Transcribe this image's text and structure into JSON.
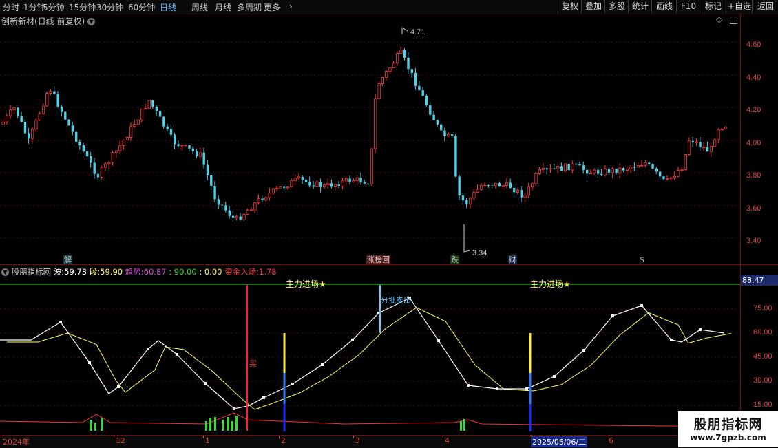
{
  "toolbar": {
    "periods": [
      "分时",
      "1分钟",
      "5分钟",
      "15分钟",
      "30分钟",
      "60分钟",
      "日线",
      "周线",
      "月线",
      "多周期",
      "更多"
    ],
    "active_period": "日线",
    "tools": [
      "复权",
      "叠加",
      "多股",
      "统计",
      "画线",
      "F10",
      "标记",
      "+自选",
      "返回"
    ]
  },
  "main_chart": {
    "title": "创新新材(日线 前复权)",
    "price_ticks": [
      "4.60",
      "4.40",
      "4.20",
      "4.00",
      "3.80",
      "3.60",
      "3.40"
    ],
    "high_label": "4.71",
    "low_label": "3.34",
    "events": [
      {
        "text": "解",
        "color": "#4fd1e8"
      },
      {
        "text": "涨榜回",
        "color": "#e0e0e0"
      },
      {
        "text": "跌",
        "color": "#33dd33"
      },
      {
        "text": "财",
        "color": "#5ab0ff"
      },
      {
        "text": "$",
        "color": "#ff3030"
      }
    ]
  },
  "indicator": {
    "name": "股朋指标网",
    "wave_label": "波:",
    "wave_value": "59.73",
    "segment_label": "段:",
    "segment_value": "59.90",
    "trend_label": "趋势:",
    "trend_value": "60.87",
    "level_90": ": 90.00",
    "level_0": ": 0.00",
    "fund_label": "资金入场:",
    "fund_value": "1.78",
    "current_value": "88.47",
    "ticks": [
      "75.00",
      "60.00",
      "45.00",
      "30.00",
      "15.00"
    ],
    "annotations": {
      "main_entry": "主力进场★",
      "buy": "买",
      "sell": "分批卖出"
    }
  },
  "dates": [
    "2024年",
    "12",
    "1",
    "2",
    "3",
    "4",
    "2025/05/06/二",
    "6"
  ],
  "watermark": {
    "title": "股朋指标网",
    "url": "www.7gpzb.com"
  }
}
